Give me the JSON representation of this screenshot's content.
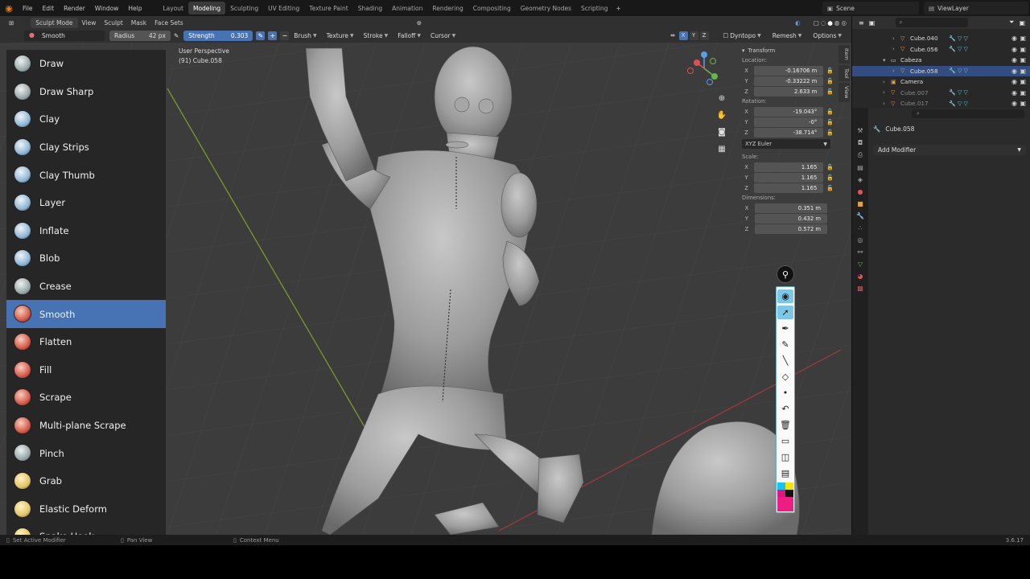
{
  "topbar": {
    "menus": [
      "File",
      "Edit",
      "Render",
      "Window",
      "Help"
    ],
    "workspaces": [
      "Layout",
      "Modeling",
      "Sculpting",
      "UV Editing",
      "Texture Paint",
      "Shading",
      "Animation",
      "Rendering",
      "Compositing",
      "Geometry Nodes",
      "Scripting"
    ],
    "active_workspace": "Modeling",
    "scene": "Scene",
    "view_layer": "ViewLayer"
  },
  "header1": {
    "mode": "Sculpt Mode",
    "menus": [
      "View",
      "Sculpt",
      "Mask",
      "Face Sets"
    ]
  },
  "header2": {
    "brush": "Smooth",
    "radius_label": "Radius",
    "radius_value": "42 px",
    "strength_label": "Strength",
    "strength_value": "0.303",
    "dropdowns": [
      "Brush",
      "Texture",
      "Stroke",
      "Falloff",
      "Cursor"
    ],
    "axes": [
      "X",
      "Y",
      "Z"
    ],
    "right": [
      "Dyntopo",
      "Remesh",
      "Options"
    ]
  },
  "tools": [
    {
      "name": "Draw",
      "color": "grey"
    },
    {
      "name": "Draw Sharp",
      "color": "grey"
    },
    {
      "name": "Clay",
      "color": "blue"
    },
    {
      "name": "Clay Strips",
      "color": "blue"
    },
    {
      "name": "Clay Thumb",
      "color": "blue"
    },
    {
      "name": "Layer",
      "color": "blue"
    },
    {
      "name": "Inflate",
      "color": "blue"
    },
    {
      "name": "Blob",
      "color": "blue"
    },
    {
      "name": "Crease",
      "color": "grey"
    },
    {
      "name": "Smooth",
      "color": "red"
    },
    {
      "name": "Flatten",
      "color": "red"
    },
    {
      "name": "Fill",
      "color": "red"
    },
    {
      "name": "Scrape",
      "color": "red"
    },
    {
      "name": "Multi-plane Scrape",
      "color": "red"
    },
    {
      "name": "Pinch",
      "color": "grey"
    },
    {
      "name": "Grab",
      "color": "yellow"
    },
    {
      "name": "Elastic Deform",
      "color": "yellow"
    },
    {
      "name": "Snake Hook",
      "color": "yellow"
    }
  ],
  "active_tool": "Smooth",
  "viewport": {
    "perspective": "User Perspective",
    "object": "(91) Cube.058"
  },
  "npanel": {
    "title": "Transform",
    "location_label": "Location:",
    "location": [
      {
        "ax": "X",
        "v": "-0.16706 m"
      },
      {
        "ax": "Y",
        "v": "-0.33222 m"
      },
      {
        "ax": "Z",
        "v": "2.633 m"
      }
    ],
    "rotation_label": "Rotation:",
    "rotation": [
      {
        "ax": "X",
        "v": "-19.043°"
      },
      {
        "ax": "Y",
        "v": "-0°"
      },
      {
        "ax": "Z",
        "v": "-38.714°"
      }
    ],
    "euler": "XYZ Euler",
    "scale_label": "Scale:",
    "scale": [
      {
        "ax": "X",
        "v": "1.165"
      },
      {
        "ax": "Y",
        "v": "1.165"
      },
      {
        "ax": "Z",
        "v": "1.165"
      }
    ],
    "dim_label": "Dimensions:",
    "dimensions": [
      {
        "ax": "X",
        "v": "0.351 m"
      },
      {
        "ax": "Y",
        "v": "0.432 m"
      },
      {
        "ax": "Z",
        "v": "0.572 m"
      }
    ],
    "tabs": [
      "Item",
      "Tool",
      "View"
    ]
  },
  "outliner": {
    "rows": [
      {
        "name": "Cube.040",
        "indent": 2,
        "kind": "mesh",
        "sel": false,
        "dim": false
      },
      {
        "name": "Cube.056",
        "indent": 2,
        "kind": "mesh",
        "sel": false,
        "dim": false
      },
      {
        "name": "Cabeza",
        "indent": 1,
        "kind": "collection",
        "sel": false,
        "dim": false
      },
      {
        "name": "Cube.058",
        "indent": 2,
        "kind": "mesh",
        "sel": true,
        "dim": false
      },
      {
        "name": "Camera",
        "indent": 1,
        "kind": "camera",
        "sel": false,
        "dim": false
      },
      {
        "name": "Cube.007",
        "indent": 1,
        "kind": "mesh",
        "sel": false,
        "dim": true
      },
      {
        "name": "Cube.017",
        "indent": 1,
        "kind": "mesh",
        "sel": false,
        "dim": true
      }
    ]
  },
  "properties": {
    "object": "Cube.058",
    "add_modifier": "Add Modifier"
  },
  "status": {
    "left": "Set Active Modifier",
    "mid": "Pan View",
    "right": "Context Menu",
    "version": "3.6.17"
  }
}
